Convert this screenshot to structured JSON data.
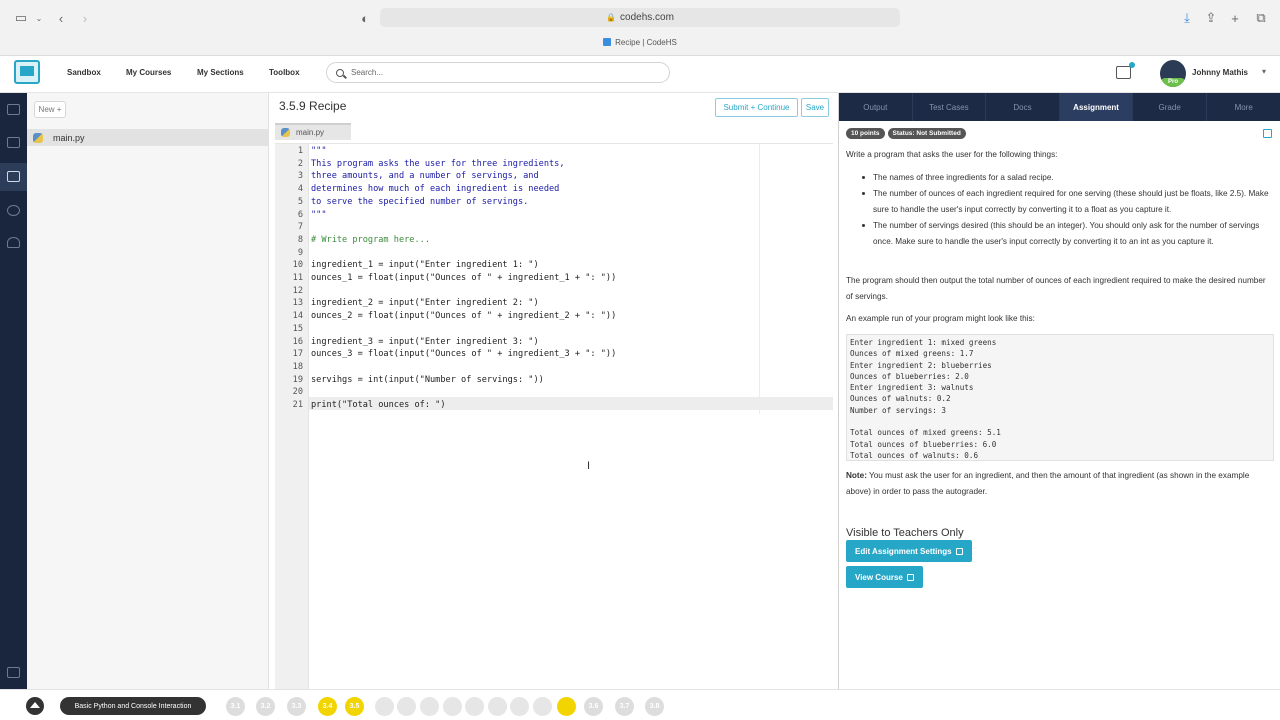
{
  "browser": {
    "url": "codehs.com",
    "tab_title": "Recipe | CodeHS"
  },
  "header": {
    "nav": [
      "Sandbox",
      "My Courses",
      "My Sections",
      "Toolbox"
    ],
    "search_placeholder": "Search...",
    "user_name": "Johnny Mathis",
    "pro_badge": "Pro"
  },
  "file_panel": {
    "new_button": "New +",
    "files": [
      "main.py"
    ]
  },
  "editor": {
    "title": "3.5.9 Recipe",
    "submit_label": "Submit + Continue",
    "save_label": "Save",
    "tab_label": "main.py",
    "current_line": 21,
    "lines": [
      "\"\"\"",
      "This program asks the user for three ingredients,",
      "three amounts, and a number of servings, and",
      "determines how much of each ingredient is needed",
      "to serve the specified number of servings.",
      "\"\"\"",
      "",
      "# Write program here...",
      "",
      "ingredient_1 = input(\"Enter ingredient 1: \")",
      "ounces_1 = float(input(\"Ounces of \" + ingredient_1 + \": \"))",
      "",
      "ingredient_2 = input(\"Enter ingredient 2: \")",
      "ounces_2 = float(input(\"Ounces of \" + ingredient_2 + \": \"))",
      "",
      "ingredient_3 = input(\"Enter ingredient 3: \")",
      "ounces_3 = float(input(\"Ounces of \" + ingredient_3 + \": \"))",
      "",
      "servihgs = int(input(\"Number of servings: \"))",
      "",
      "print(\"Total ounces of: \")"
    ]
  },
  "right_panel": {
    "tabs": [
      "Output",
      "Test Cases",
      "Docs",
      "Assignment",
      "Grade",
      "More"
    ],
    "active_tab": "Assignment",
    "badges": [
      "10 points",
      "Status: Not Submitted"
    ],
    "intro": "Write a program that asks the user for the following things:",
    "bullets": [
      "The names of three ingredients for a salad recipe.",
      "The number of ounces of each ingredient required for one serving (these should just be floats, like 2.5). Make sure to handle the user's input correctly by converting it to a float as you capture it.",
      "The number of servings desired (this should be an integer). You should only ask for the number of servings once. Make sure to handle the user's input correctly by converting it to an int as you capture it."
    ],
    "output_text": "The program should then output the total number of ounces of each ingredient required to make the desired number of servings.",
    "example_intro": "An example run of your program might look like this:",
    "example_lines": [
      "Enter ingredient 1: mixed greens",
      "Ounces of mixed greens: 1.7",
      "Enter ingredient 2: blueberries",
      "Ounces of blueberries: 2.0",
      "Enter ingredient 3: walnuts",
      "Ounces of walnuts: 0.2",
      "Number of servings: 3",
      "",
      "Total ounces of mixed greens: 5.1",
      "Total ounces of blueberries: 6.0",
      "Total ounces of walnuts: 0.6"
    ],
    "note_label": "Note:",
    "note_text": " You must ask the user for an ingredient, and then the amount of that ingredient (as shown in the example above) in order to pass the autograder.",
    "teachers_heading": "Visible to Teachers Only",
    "edit_settings_label": "Edit Assignment Settings",
    "view_course_label": "View Course"
  },
  "bottom_bar": {
    "unit_label": "Basic Python and Console Interaction",
    "lessons": [
      "3.1",
      "3.2",
      "3.3",
      "3.4",
      "3.5",
      "",
      "",
      "",
      "",
      "",
      "",
      "",
      "",
      "",
      "",
      "3.6",
      "3.7",
      "3.8"
    ]
  },
  "colors": {
    "accent": "#27a7c8",
    "dark_nav": "#1c2a45",
    "lesson_current": "#f2d500"
  }
}
